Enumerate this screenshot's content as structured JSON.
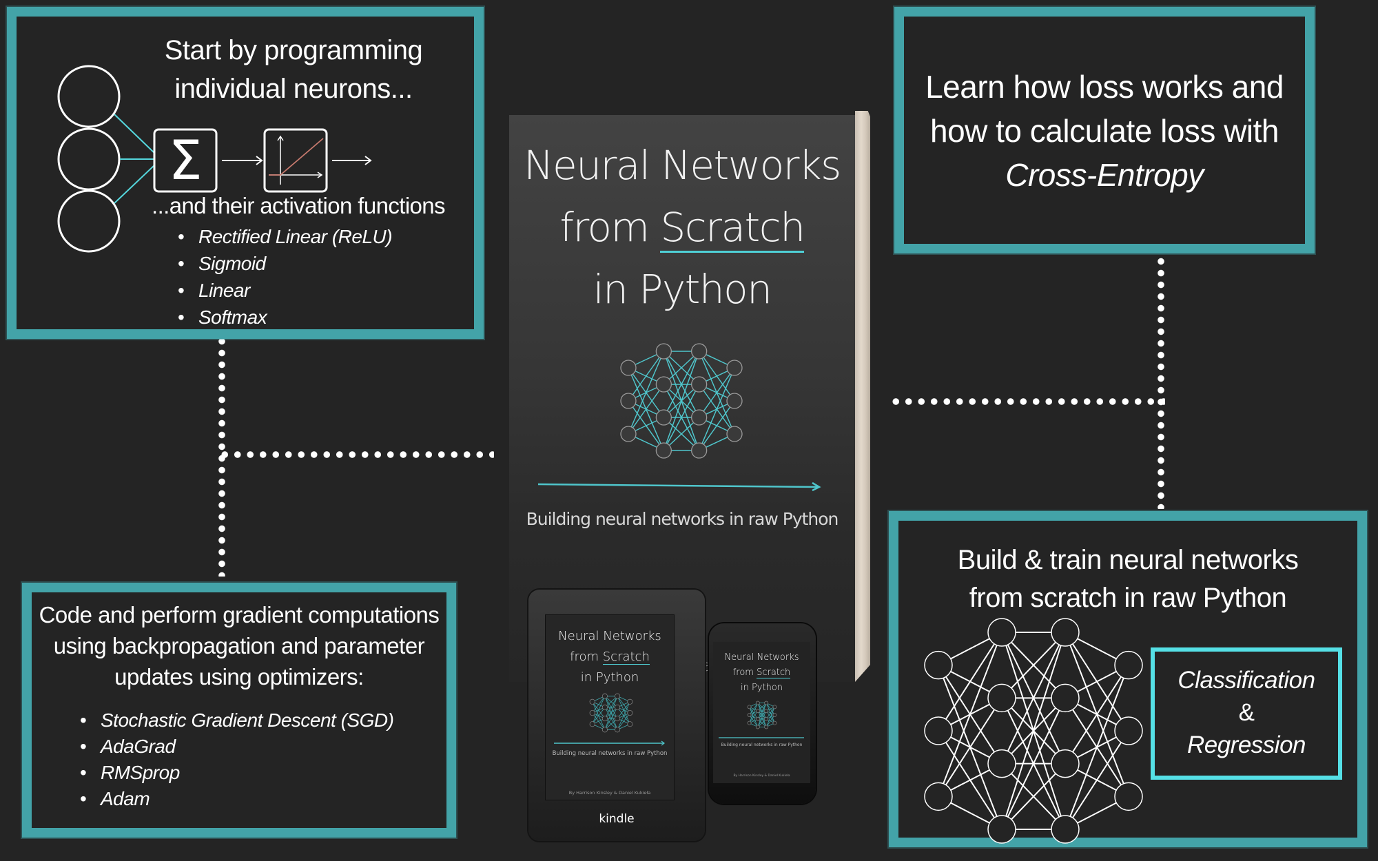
{
  "colors": {
    "background": "#242424",
    "panel_border": "#43a3a8",
    "accent_cyan": "#55e0e6",
    "text": "#ffffff",
    "relu_line": "#c87a6e"
  },
  "panel_neurons": {
    "heading_line1": "Start by programming",
    "heading_line2": "individual neurons...",
    "sum_symbol": "Σ",
    "subheading": "...and their activation functions",
    "activations": [
      "Rectified Linear (ReLU)",
      "Sigmoid",
      "Linear",
      "Softmax"
    ]
  },
  "panel_loss": {
    "line1": "Learn how loss works and",
    "line2": "how to calculate loss with",
    "line3": "Cross-Entropy"
  },
  "panel_backprop": {
    "line1": "Code and perform gradient computations",
    "line2": "using backpropagation and parameter",
    "line3": "updates using optimizers:",
    "optimizers": [
      "Stochastic Gradient Descent (SGD)",
      "AdaGrad",
      "RMSprop",
      "Adam"
    ]
  },
  "panel_build": {
    "line1": "Build & train neural networks",
    "line2": "from scratch in raw Python",
    "tasks_line1": "Classification",
    "tasks_line2": "&",
    "tasks_line3": "Regression",
    "network_layers": [
      3,
      4,
      4,
      3
    ]
  },
  "book": {
    "title_line1": "Neural Networks",
    "title_line2_a": "from ",
    "title_line2_b": "Scratch",
    "title_line3": "in Python",
    "subtitle": "Building neural networks in raw Python",
    "authors": "By Harrison Kinsley & Daniel Kukieła",
    "network_layers": [
      3,
      4,
      4,
      3
    ],
    "partial_author_text": "Dani"
  },
  "devices": {
    "kindle_label": "kindle"
  }
}
